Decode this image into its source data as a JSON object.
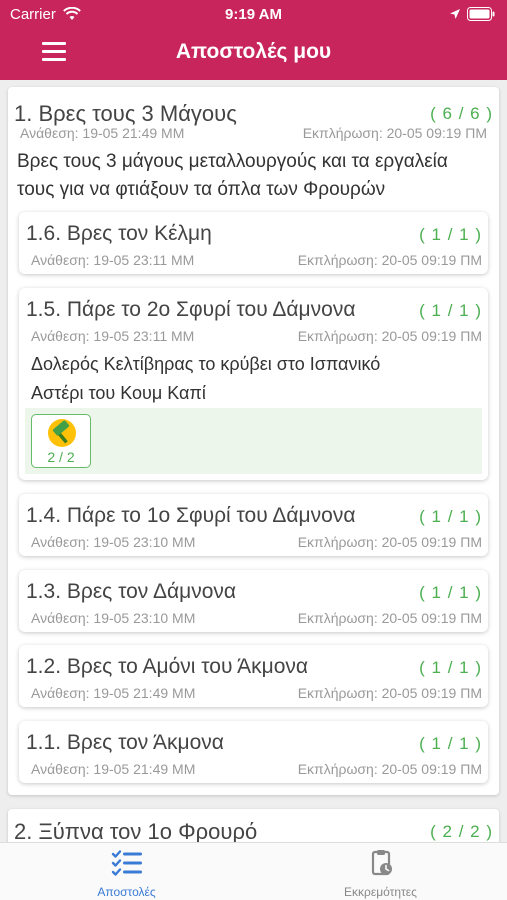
{
  "status_bar": {
    "carrier": "Carrier",
    "time": "9:19 AM"
  },
  "header": {
    "title": "Αποστολές μου"
  },
  "missions": [
    {
      "title": "1. Βρες τους 3 Μάγους",
      "count": "( 6 / 6 )",
      "assigned": "Ανάθεση: 19-05 21:49 ΜΜ",
      "completed": "Εκπλήρωση: 20-05 09:19 ΠΜ",
      "description_line1": "Βρες τους 3 μάγους μεταλλουργούς και τα εργαλεία",
      "description_line2": "τους για να φτιάξουν τα όπλα των Φρουρών",
      "subtasks": [
        {
          "title": "1.6. Βρες τον Κέλμη",
          "count": "( 1 / 1 )",
          "assigned": "Ανάθεση: 19-05 23:11 ΜΜ",
          "completed": "Εκπλήρωση: 20-05 09:19 ΠΜ"
        },
        {
          "title": "1.5. Πάρε το 2ο Σφυρί του Δάμνονα",
          "count": "( 1 / 1 )",
          "assigned": "Ανάθεση: 19-05 23:11 ΜΜ",
          "completed": "Εκπλήρωση: 20-05 09:19 ΠΜ",
          "description_line1": "Δολερός Κελτίβηρας το κρύβει στο Ισπανικό",
          "description_line2": "Αστέρι του Κουμ Καπί",
          "item": {
            "icon": "hammer-icon",
            "count": "2 / 2"
          }
        },
        {
          "title": "1.4. Πάρε το 1ο Σφυρί του Δάμνονα",
          "count": "( 1 / 1 )",
          "assigned": "Ανάθεση: 19-05 23:10 ΜΜ",
          "completed": "Εκπλήρωση: 20-05 09:19 ΠΜ"
        },
        {
          "title": "1.3. Βρες τον Δάμνονα",
          "count": "( 1 / 1 )",
          "assigned": "Ανάθεση: 19-05 23:10 ΜΜ",
          "completed": "Εκπλήρωση: 20-05 09:19 ΠΜ"
        },
        {
          "title": "1.2. Βρες το Αμόνι του Άκμονα",
          "count": "( 1 / 1 )",
          "assigned": "Ανάθεση: 19-05 21:49 ΜΜ",
          "completed": "Εκπλήρωση: 20-05 09:19 ΠΜ"
        },
        {
          "title": "1.1. Βρες τον Άκμονα",
          "count": "( 1 / 1 )",
          "assigned": "Ανάθεση: 19-05 21:49 ΜΜ",
          "completed": "Εκπλήρωση: 20-05 09:19 ΠΜ"
        }
      ]
    },
    {
      "title": "2. Ξύπνα τον 1ο Φρουρό",
      "count": "( 2 / 2 )"
    }
  ],
  "tabs": [
    {
      "label": "Αποστολές",
      "icon": "checklist-icon",
      "active": true
    },
    {
      "label": "Εκκρεμότητες",
      "icon": "clipboard-clock-icon",
      "active": false
    }
  ],
  "colors": {
    "header": "#c8255d",
    "count_green": "#4caf50",
    "active_tab": "#3a7bd5"
  }
}
